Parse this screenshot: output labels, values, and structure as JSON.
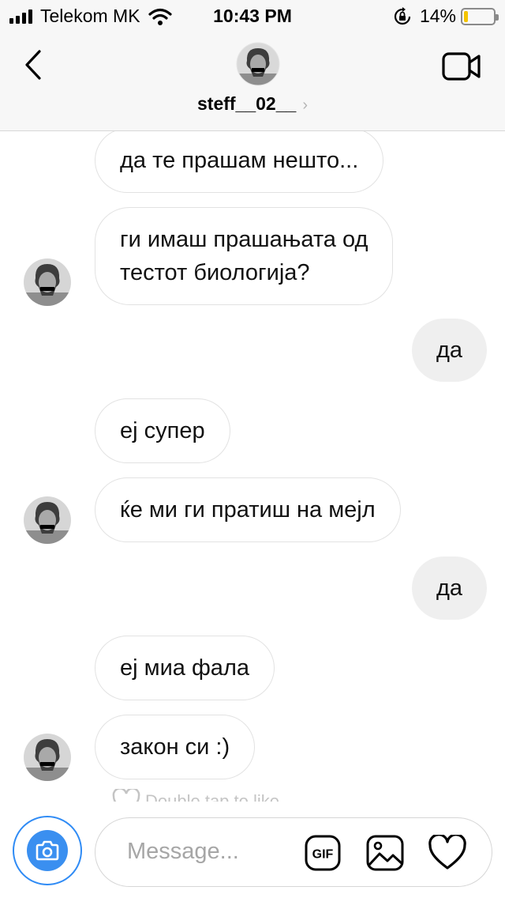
{
  "status_bar": {
    "carrier": "Telekom MK",
    "time": "10:43 PM",
    "battery_percent": "14%",
    "battery_level": 0.14,
    "battery_color": "#f4c400",
    "icons": [
      "signal-icon",
      "wifi-icon",
      "rotation-lock-icon",
      "battery-icon"
    ]
  },
  "header": {
    "username": "steff__02__",
    "chevron": "›",
    "icons": [
      "back-chevron-icon",
      "avatar",
      "video-call-icon"
    ]
  },
  "messages": [
    {
      "side": "in",
      "lines": [
        "да те прашам нешто..."
      ]
    },
    {
      "side": "in",
      "lines": [
        "ги имаш прашањата од",
        "тестот биологија?"
      ],
      "avatar": true
    },
    {
      "side": "out",
      "lines": [
        "да"
      ]
    },
    {
      "side": "in",
      "lines": [
        "еј супер"
      ]
    },
    {
      "side": "in",
      "lines": [
        "ќе ми ги пратиш на мејл"
      ],
      "avatar": true
    },
    {
      "side": "out",
      "lines": [
        "да"
      ]
    },
    {
      "side": "in",
      "lines": [
        "еј миа фала"
      ]
    },
    {
      "side": "in",
      "lines": [
        "закон си :)"
      ],
      "avatar": true
    }
  ],
  "like_hint": "Double tap to like",
  "composer": {
    "placeholder": "Message...",
    "gif_label": "GIF",
    "accent_color": "#3a8ff0",
    "icons": [
      "camera-icon",
      "gif-icon",
      "gallery-icon",
      "heart-icon"
    ]
  }
}
